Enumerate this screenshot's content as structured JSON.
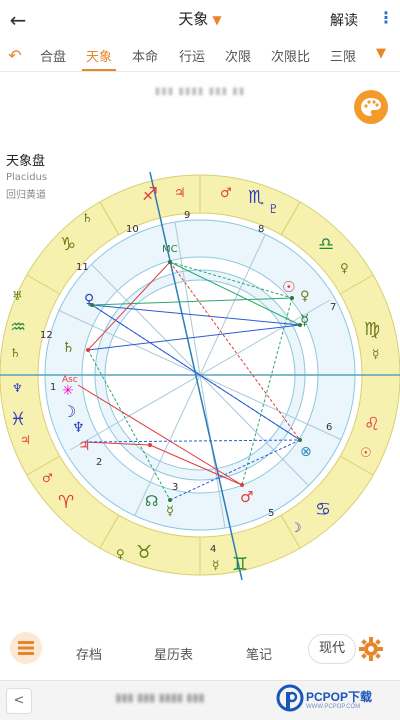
{
  "header": {
    "back_icon": "arrow-left-icon",
    "title": "天象",
    "title_dropdown_icon": "chevron-down-icon",
    "interpret_label": "解读",
    "more_icon": "more-vertical-icon"
  },
  "tabs": {
    "undo_icon": "undo-icon",
    "items": [
      {
        "label": "合盘",
        "active": false
      },
      {
        "label": "天象",
        "active": true
      },
      {
        "label": "本命",
        "active": false
      },
      {
        "label": "行运",
        "active": false
      },
      {
        "label": "次限",
        "active": false
      },
      {
        "label": "次限比",
        "active": false
      },
      {
        "label": "三限",
        "active": false
      }
    ],
    "more_icon": "chevron-down-icon",
    "accent_color": "#e8852a"
  },
  "chart_info": {
    "name": "天象盘",
    "house_system": "Placidus",
    "zodiac": "回归黄道"
  },
  "chart": {
    "mc_label": "MC",
    "asc_label": "Asc",
    "house_numbers": [
      "1",
      "2",
      "3",
      "4",
      "5",
      "6",
      "7",
      "8",
      "9",
      "10",
      "11",
      "12"
    ],
    "sign_color_fire": "#e23b3b",
    "sign_color_earth": "#6a7a1a",
    "sign_color_air": "#1f8a3a",
    "sign_color_water": "#2b3fbf",
    "ring_color": "#f5eea3"
  },
  "bottom_bar": {
    "list_icon": "list-icon",
    "archive_label": "存档",
    "ephemeris_label": "星历表",
    "notes_label": "笔记",
    "modern_label": "现代",
    "settings_icon": "gear-icon"
  },
  "footer": {
    "prev_icon": "chevron-left-icon",
    "watermark_text": "PCPOP下载",
    "watermark_sub": "WWW.PCPOP.COM"
  }
}
